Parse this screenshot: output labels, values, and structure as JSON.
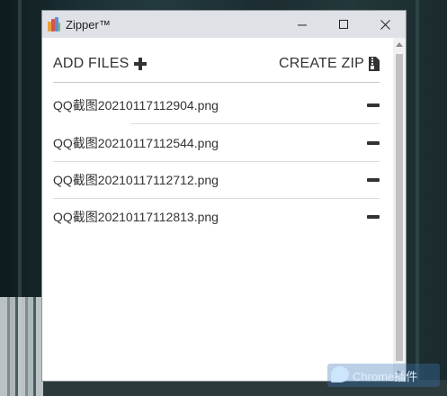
{
  "window": {
    "title": "Zipper™",
    "minimize_icon": "minimize-icon",
    "maximize_icon": "maximize-icon",
    "close_icon": "close-icon"
  },
  "toolbar": {
    "add_files_label": "ADD FILES",
    "add_files_icon": "plus-icon",
    "create_zip_label": "CREATE ZIP",
    "create_zip_icon": "zip-file-icon"
  },
  "files": [
    {
      "name": "QQ截图20210117112904.png",
      "action_icon": "minus-icon"
    },
    {
      "name": "QQ截图20210117112544.png",
      "action_icon": "minus-icon"
    },
    {
      "name": "QQ截图20210117112712.png",
      "action_icon": "minus-icon"
    },
    {
      "name": "QQ截图20210117112813.png",
      "action_icon": "minus-icon"
    }
  ],
  "watermark": {
    "text": "Chrome插件"
  },
  "colors": {
    "titlebar": "#dee1e6",
    "text": "#333333",
    "scroll_thumb": "#c1c1c1"
  }
}
